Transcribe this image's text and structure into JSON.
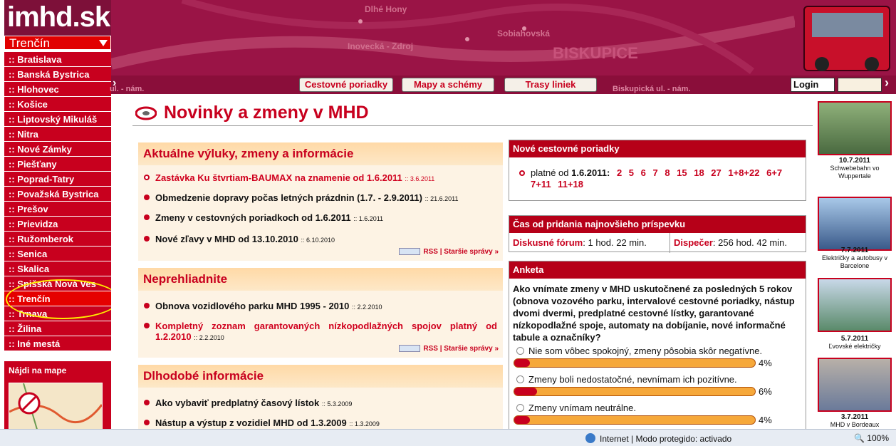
{
  "logo": {
    "main": "imhd",
    "suffix": ".sk"
  },
  "city_select": "Trenčín",
  "cities": [
    ":: Bratislava",
    ":: Banská Bystrica",
    ":: Hlohovec",
    ":: Košice",
    ":: Liptovský Mikuláš",
    ":: Nitra",
    ":: Nové Zámky",
    ":: Piešťany",
    ":: Poprad-Tatry",
    ":: Považská Bystrica",
    ":: Prešov",
    ":: Prievidza",
    ":: Ružomberok",
    ":: Senica",
    ":: Skalica",
    ":: Spišská Nová Ves",
    ":: Trenčín",
    ":: Trnava",
    ":: Žilina",
    ":: Iné mestá"
  ],
  "selected_city_index": 16,
  "map_label": "Nájdi na mape",
  "header_text": {
    "t1": "Dlhé Hony",
    "t2": "Sobiahovská",
    "t3": "Inovecká - Zdroj",
    "t4": "BISKUPICE",
    "t5": "Biskupická ul. - nám.",
    "t6": "ul. - nám."
  },
  "nav": {
    "schedules": "Cestovné poriadky",
    "maps": "Mapy a schémy",
    "routes": "Trasy liniek",
    "login": "Login"
  },
  "page_title": "Novinky a zmeny v MHD",
  "panel1": {
    "title": "Aktuálne výluky, zmeny a informácie",
    "items": [
      {
        "text": "Zastávka Ku štvrtiam-BAUMAX na znamenie od 1.6.2011",
        "date": ":: 3.6.2011"
      },
      {
        "text": "Obmedzenie dopravy počas letných prázdnin (1.7. - 2.9.2011)",
        "date": ":: 21.6.2011"
      },
      {
        "text": "Zmeny v cestovných poriadkoch od 1.6.2011",
        "date": ":: 1.6.2011"
      },
      {
        "text": "Nové zľavy v MHD od 13.10.2010",
        "date": ":: 6.10.2010"
      }
    ],
    "rss": "RSS",
    "older": "Staršie správy »",
    "sep": "|"
  },
  "panel2": {
    "title": "Neprehliadnite",
    "items": [
      {
        "text": "Obnova vozidlového parku MHD 1995 - 2010",
        "date": ":: 2.2.2010"
      },
      {
        "text": "Kompletný zoznam garantovaných nízkopodlažných spojov platný od 1.2.2010",
        "date": ":: 2.2.2010"
      }
    ],
    "rss": "RSS",
    "older": "Staršie správy »",
    "sep": "|"
  },
  "panel3": {
    "title": "Dlhodobé informácie",
    "items": [
      {
        "text": "Ako vybaviť predplatný časový lístok",
        "date": ":: 5.3.2009"
      },
      {
        "text": "Nástup a výstup z vozidiel MHD od 1.3.2009",
        "date": ":: 1.3.2009"
      }
    ]
  },
  "new_schedules": {
    "title": "Nové cestovné poriadky",
    "prefix": "platné od ",
    "date": "1.6.2011:",
    "lines": "2 5 6 7 8 15 18 27 1+8+22 6+7 7+11 11+18"
  },
  "last_post": {
    "title": "Čas od pridania najnovšieho príspevku",
    "forum_label": "Diskusné fórum",
    "forum_value": ": 1 hod. 22 min.",
    "dispatcher_label": "Dispečer",
    "dispatcher_value": ": 256 hod. 42 min."
  },
  "poll": {
    "title": "Anketa",
    "question": "Ako vnímate zmeny v MHD uskutočnené za posledných 5 rokov (obnova vozového parku, intervalové cestovné poriadky, nástup dvomi dvermi, predplatné cestovné lístky, garantované nízkopodlažné spoje, automaty na dobíjanie, nové informačné tabule a označníky?",
    "options": [
      {
        "label": "Nie som vôbec spokojný, zmeny pôsobia skôr negatívne.",
        "pct": "4%",
        "value": 4
      },
      {
        "label": "Zmeny boli nedostatočné, nevnímam ich pozitívne.",
        "pct": "6%",
        "value": 6
      },
      {
        "label": "Zmeny vnímam neutrálne.",
        "pct": "4%",
        "value": 4
      }
    ]
  },
  "thumbs": [
    {
      "date": "10.7.2011",
      "caption": "Schwebebahn vo Wuppertale"
    },
    {
      "date": "7.7.2011",
      "caption": "Električky a autobusy v Barcelone"
    },
    {
      "date": "5.7.2011",
      "caption": "Ľvovské električky"
    },
    {
      "date": "3.7.2011",
      "caption": "MHD v Bordeaux"
    }
  ],
  "status": {
    "zone": "Internet | Modo protegido: activado",
    "zoom": "100%"
  }
}
